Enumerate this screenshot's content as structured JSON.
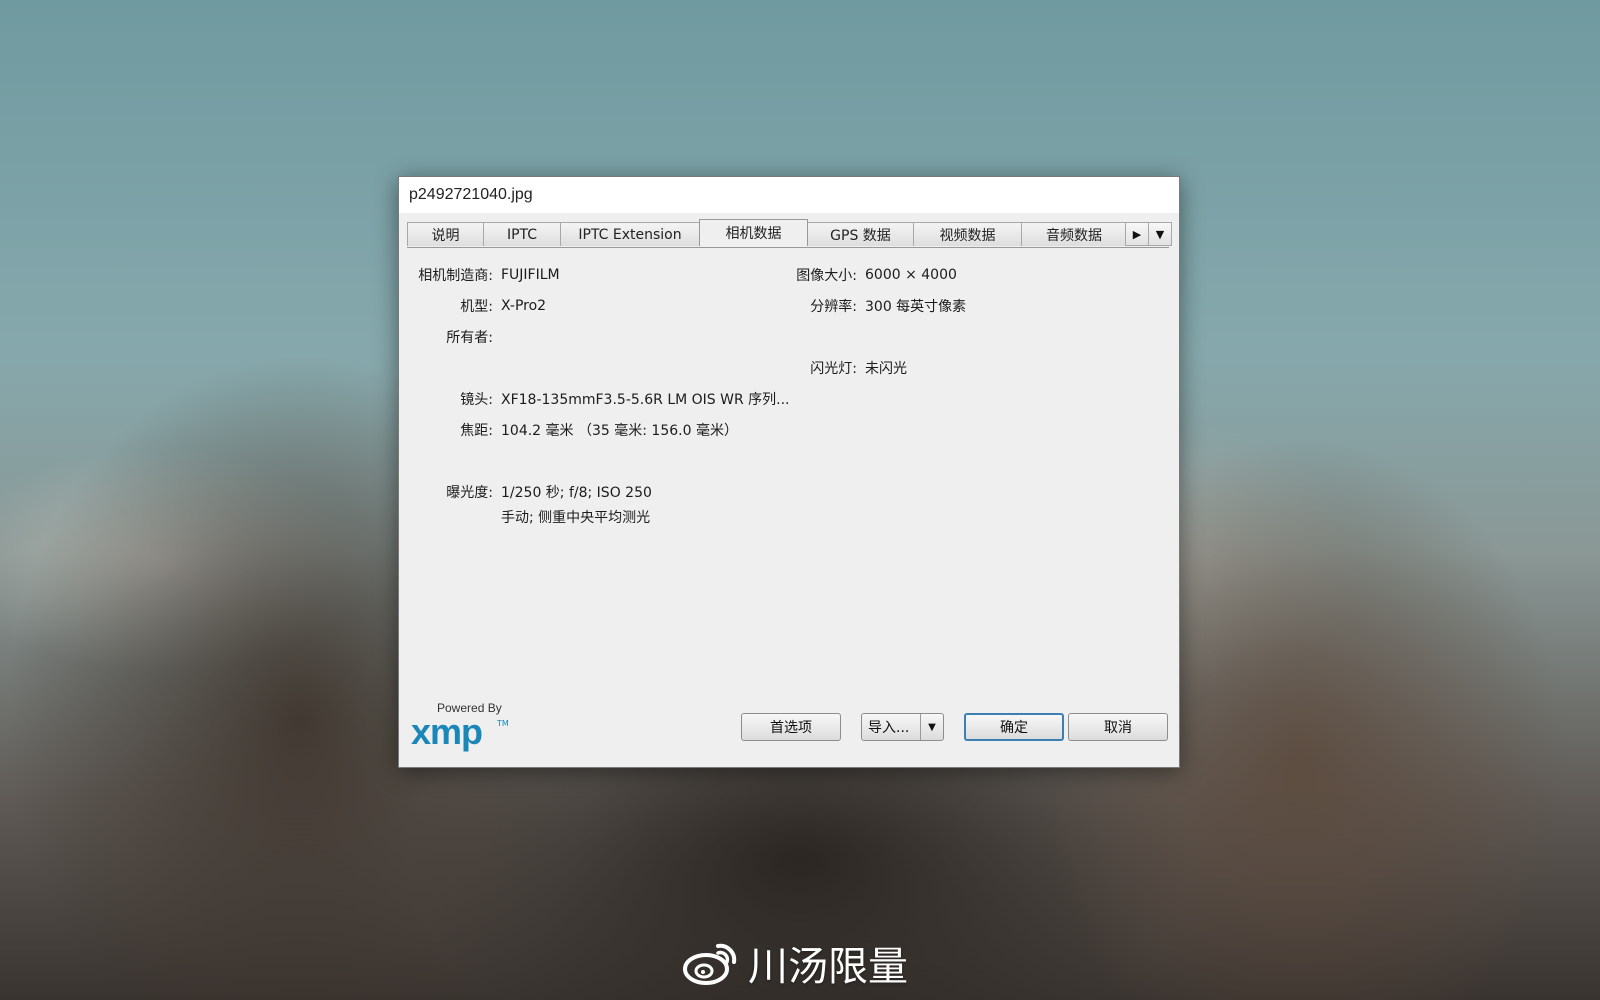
{
  "window": {
    "title": "p2492721040.jpg"
  },
  "tabs": [
    {
      "label": "说明"
    },
    {
      "label": "IPTC"
    },
    {
      "label": "IPTC Extension"
    },
    {
      "label": "相机数据",
      "active": true
    },
    {
      "label": "GPS 数据"
    },
    {
      "label": "视频数据"
    },
    {
      "label": "音频数据"
    }
  ],
  "tab_scroll_icon": "triangle-right",
  "tab_menu_icon": "triangle-down",
  "camera": {
    "make_label": "相机制造商:",
    "make_value": "FUJIFILM",
    "model_label": "机型:",
    "model_value": "X-Pro2",
    "owner_label": "所有者:",
    "owner_value": "",
    "lens_label": "镜头:",
    "lens_value": "XF18-135mmF3.5-5.6R LM OIS WR   序列...",
    "focal_label": "焦距:",
    "focal_value": "104.2 毫米  （35 毫米: 156.0 毫米）",
    "exposure_label": "曝光度:",
    "exposure_value": "1/250 秒;  f/8;  ISO 250",
    "exposure_value2": "手动;  侧重中央平均测光",
    "size_label": "图像大小:",
    "size_value": "6000 × 4000",
    "resolution_label": "分辨率:",
    "resolution_value": "300 每英寸像素",
    "flash_label": "闪光灯:",
    "flash_value": "未闪光"
  },
  "footer": {
    "logo_powered": "Powered By",
    "logo_text": "xmp",
    "logo_tm": "TM",
    "prefs_label": "首选项",
    "import_label": "导入...",
    "ok_label": "确定",
    "cancel_label": "取消"
  },
  "watermark": {
    "text": "川汤限量",
    "icon": "weibo-icon"
  },
  "colors": {
    "accent": "#1b86b8",
    "default_button_border": "#3c7fb1"
  }
}
